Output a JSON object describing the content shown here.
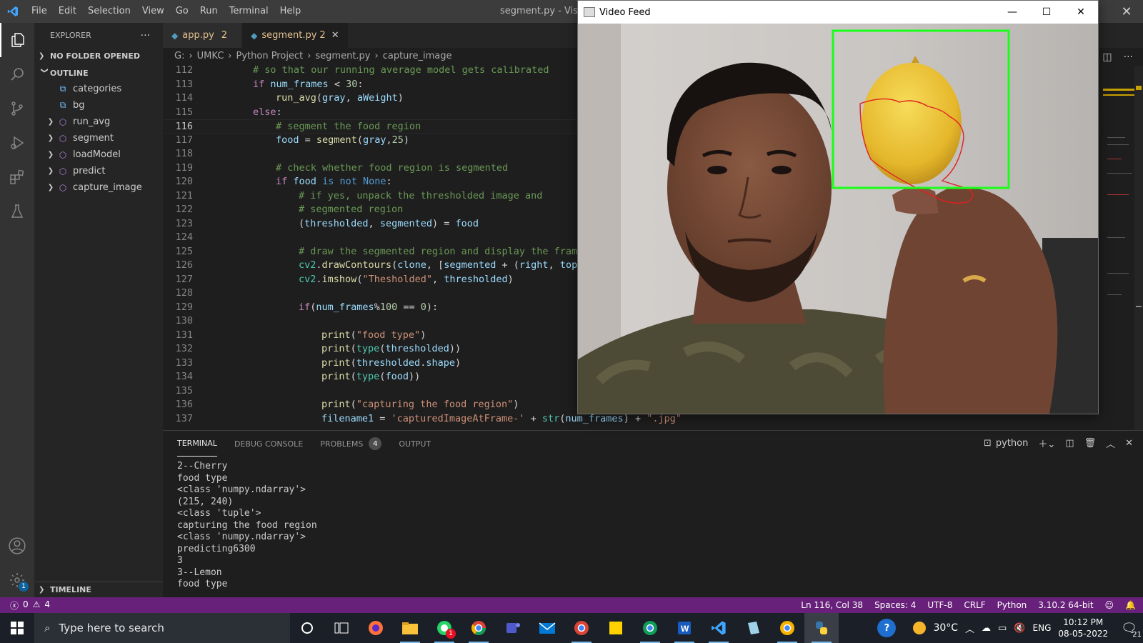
{
  "menubar": [
    "File",
    "Edit",
    "Selection",
    "View",
    "Go",
    "Run",
    "Terminal",
    "Help"
  ],
  "window_title": "segment.py - Visu",
  "sidebar": {
    "header": "EXPLORER",
    "no_folder": "NO FOLDER OPENED",
    "outline_title": "OUTLINE",
    "outline_items": [
      {
        "label": "categories",
        "kind": "variable"
      },
      {
        "label": "bg",
        "kind": "variable"
      },
      {
        "label": "run_avg",
        "kind": "function"
      },
      {
        "label": "segment",
        "kind": "function"
      },
      {
        "label": "loadModel",
        "kind": "function"
      },
      {
        "label": "predict",
        "kind": "function"
      },
      {
        "label": "capture_image",
        "kind": "function"
      }
    ],
    "timeline": "TIMELINE"
  },
  "tabs": [
    {
      "label": "app.py",
      "problems": "2"
    },
    {
      "label": "segment.py",
      "problems": "2"
    }
  ],
  "breadcrumb": [
    "G:",
    "UMKC",
    "Python Project",
    "segment.py",
    "capture_image"
  ],
  "code": {
    "lines": [
      {
        "n": "112",
        "html": "<span class='cm'># so that our running average model gets calibrated</span>",
        "indent": 2
      },
      {
        "n": "113",
        "html": "<span class='kw'>if</span> <span class='vr'>num_frames</span> &lt; <span class='nm'>30</span>:",
        "indent": 2
      },
      {
        "n": "114",
        "html": "<span class='fn'>run_avg</span>(<span class='vr'>gray</span>, <span class='vr'>aWeight</span>)",
        "indent": 3
      },
      {
        "n": "115",
        "html": "<span class='kw'>else</span>:",
        "indent": 2
      },
      {
        "n": "116",
        "html": "<span class='cm'># segment the food region</span>",
        "indent": 3
      },
      {
        "n": "117",
        "html": "<span class='vr'>food</span> = <span class='fn'>segment</span>(<span class='vr'>gray</span>,<span class='nm'>25</span>)",
        "indent": 3
      },
      {
        "n": "118",
        "html": "",
        "indent": 3
      },
      {
        "n": "119",
        "html": "<span class='cm'># check whether food region is segmented</span>",
        "indent": 3
      },
      {
        "n": "120",
        "html": "<span class='kw'>if</span> <span class='vr'>food</span> <span class='bl'>is not</span> <span class='bl'>None</span>:",
        "indent": 3
      },
      {
        "n": "121",
        "html": "<span class='cm'># if yes, unpack the thresholded image and</span>",
        "indent": 4
      },
      {
        "n": "122",
        "html": "<span class='cm'># segmented region</span>",
        "indent": 4
      },
      {
        "n": "123",
        "html": "(<span class='vr'>thresholded</span>, <span class='vr'>segmented</span>) = <span class='vr'>food</span>",
        "indent": 4
      },
      {
        "n": "124",
        "html": "",
        "indent": 4
      },
      {
        "n": "125",
        "html": "<span class='cm'># draw the segmented region and display the fram</span>",
        "indent": 4
      },
      {
        "n": "126",
        "html": "<span class='cl'>cv2</span>.<span class='fn'>drawContours</span>(<span class='vr'>clone</span>, [<span class='vr'>segmented</span> + (<span class='vr'>right</span>, <span class='vr'>top</span>",
        "indent": 4
      },
      {
        "n": "127",
        "html": "<span class='cl'>cv2</span>.<span class='fn'>imshow</span>(<span class='st'>\"Thesholded\"</span>, <span class='vr'>thresholded</span>)",
        "indent": 4
      },
      {
        "n": "128",
        "html": "",
        "indent": 4
      },
      {
        "n": "129",
        "html": "<span class='kw'>if</span>(<span class='vr'>num_frames</span>%<span class='nm'>100</span> == <span class='nm'>0</span>):",
        "indent": 4
      },
      {
        "n": "130",
        "html": "",
        "indent": 5
      },
      {
        "n": "131",
        "html": "<span class='fn'>print</span>(<span class='st'>\"food type\"</span>)",
        "indent": 5
      },
      {
        "n": "132",
        "html": "<span class='fn'>print</span>(<span class='cl'>type</span>(<span class='vr'>thresholded</span>))",
        "indent": 5
      },
      {
        "n": "133",
        "html": "<span class='fn'>print</span>(<span class='vr'>thresholded</span>.<span class='vr'>shape</span>)",
        "indent": 5
      },
      {
        "n": "134",
        "html": "<span class='fn'>print</span>(<span class='cl'>type</span>(<span class='vr'>food</span>))",
        "indent": 5
      },
      {
        "n": "135",
        "html": "",
        "indent": 5
      },
      {
        "n": "136",
        "html": "<span class='fn'>print</span>(<span class='st'>\"capturing the food region\"</span>)",
        "indent": 5
      },
      {
        "n": "137",
        "html": "<span class='vr'>filename1</span> = <span class='st'>'capturedImageAtFrame-'</span> + <span class='cl'>str</span>(<span class='vr'>num_frames</span>) + <span class='st'>\".jpg\"</span>",
        "indent": 5
      }
    ],
    "current_line": "116"
  },
  "panel": {
    "tabs": [
      "TERMINAL",
      "DEBUG CONSOLE",
      "PROBLEMS",
      "OUTPUT"
    ],
    "problems_count": "4",
    "shell": "python",
    "terminal_lines": [
      "2--Cherry",
      "food type",
      "<class 'numpy.ndarray'>",
      "(215, 240)",
      "<class 'tuple'>",
      "capturing the food region",
      "<class 'numpy.ndarray'>",
      "predicting6300",
      "3",
      "3--Lemon",
      "food type"
    ]
  },
  "statusbar": {
    "errors": "0",
    "warnings": "4",
    "position": "Ln 116, Col 38",
    "spaces": "Spaces: 4",
    "encoding": "UTF-8",
    "eol": "CRLF",
    "language": "Python",
    "interpreter": "3.10.2 64-bit"
  },
  "video_window": {
    "title": "Video Feed"
  },
  "taskbar": {
    "search_placeholder": "Type here to search",
    "temperature": "30°C",
    "language": "ENG",
    "time": "10:12 PM",
    "date": "08-05-2022",
    "notifications": "21",
    "whatsapp_badge": "1"
  },
  "colors": {
    "statusbar": "#68217a",
    "roi_box": "#1aff1a",
    "contour": "#e02020"
  }
}
